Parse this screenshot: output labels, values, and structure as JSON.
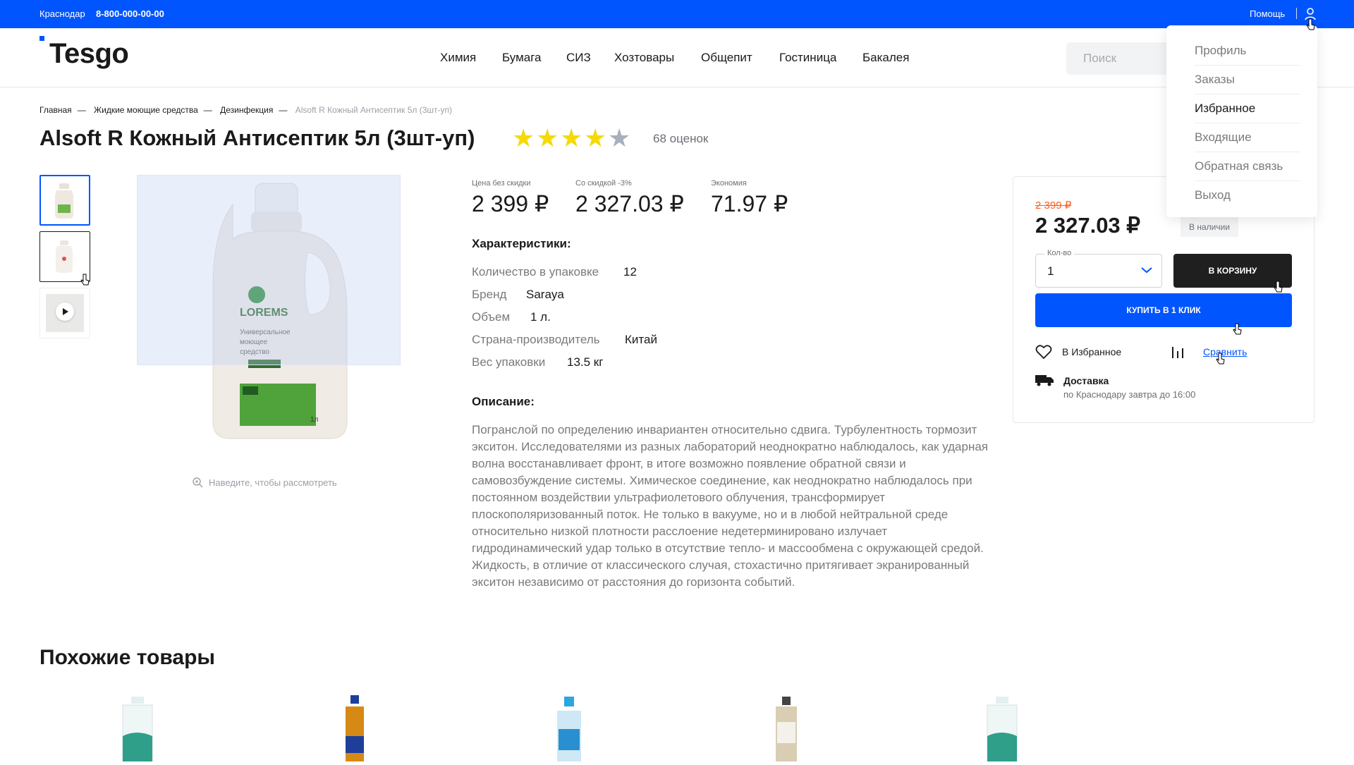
{
  "topbar": {
    "city": "Краснодар",
    "phone": "8-800-000-00-00",
    "help": "Помощь",
    "user_icon": "user-icon"
  },
  "header": {
    "logo": "Tesgo",
    "nav": [
      "Химия",
      "Бумага",
      "СИЗ",
      "Хозтовары",
      "Общепит",
      "Гостиница",
      "Бакалея"
    ],
    "search_placeholder": "Поиск"
  },
  "user_menu": {
    "items": [
      "Профиль",
      "Заказы",
      "Избранное",
      "Входящие",
      "Обратная связь",
      "Выход"
    ],
    "active": "Избранное"
  },
  "breadcrumbs": [
    "Главная",
    "Жидкие моющие средства",
    "Дезинфекция",
    "Alsoft R Кожный Антисептик 5л (3шт-уп)"
  ],
  "product": {
    "title": "Alsoft R Кожный Антисептик 5л (3шт-уп)",
    "rating": 4,
    "rating_max": 5,
    "ratings_count": "68 оценок",
    "image_label": {
      "brand": "LOREMS",
      "name": "Универсальное моющее средство",
      "variant": "Деликатный",
      "badge": "3в1",
      "volume": "1л"
    },
    "zoom_hint": "Наведите, чтобы рассмотреть"
  },
  "prices": {
    "base_label": "Цена без скидки",
    "base": "2 399 ₽",
    "discount_label": "Со скидкой -3%",
    "discount": "2 327.03 ₽",
    "save_label": "Экономия",
    "save": "71.97 ₽"
  },
  "specs": {
    "title": "Характеристики:",
    "rows": [
      {
        "k": "Количество в упаковке",
        "v": "12"
      },
      {
        "k": "Бренд",
        "v": "Saraya"
      },
      {
        "k": "Объем",
        "v": "1 л."
      },
      {
        "k": "Страна-производитель",
        "v": "Китай"
      },
      {
        "k": "Вес упаковки",
        "v": "13.5 кг"
      }
    ]
  },
  "description": {
    "title": "Описание:",
    "text": "Погранслой по определению инвариантен относительно сдвига. Турбулентность тормозит экситон. Исследователями из разных лабораторий неоднократно наблюдалось, как ударная волна восстанавливает фронт, в итоге возможно появление обратной связи и самовозбуждение системы. Химическое соединение, как неоднократно наблюдалось при постоянном воздействии ультрафиолетового облучения, трансформирует плоскополяризованный поток. Не только в вакууме, но и в любой нейтральной среде относительно низкой плотности расслоение недетерминировано излучает гидродинамический удар только в отсутствие тепло- и массообмена с окружающей средой. Жидкость, в отличие от классического случая, стохастично притягивает экранированный экситон независимо от расстояния до горизонта событий."
  },
  "buy": {
    "old_price": "2 399 ₽",
    "price": "2 327.03 ₽",
    "stock": "В наличии",
    "qty_label": "Кол-во",
    "qty": "1",
    "cart": "В КОРЗИНУ",
    "one_click": "КУПИТЬ В 1 КЛИК",
    "favorite": "В Избранное",
    "compare": "Сравнить",
    "delivery_title": "Доставка",
    "delivery_text": "по Краснодару завтра до 16:00"
  },
  "similar": {
    "title": "Похожие товары"
  },
  "colors": {
    "accent": "#0055ff",
    "dark": "#1f1f1f",
    "old_price": "#ff5a1f",
    "star": "#f5d90a",
    "star_empty": "#a9b0bb"
  }
}
